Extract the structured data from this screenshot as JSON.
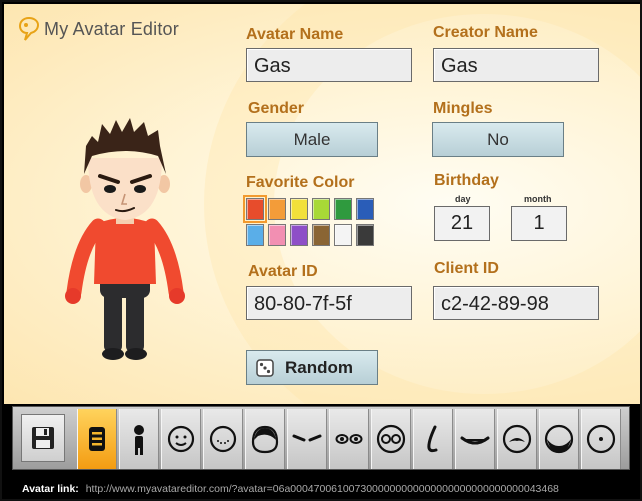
{
  "app": {
    "title": "My Avatar Editor",
    "icon": "speech-bubble-logo"
  },
  "form": {
    "avatar_name_label": "Avatar Name",
    "avatar_name_value": "Gas",
    "creator_name_label": "Creator Name",
    "creator_name_value": "Gas",
    "gender_label": "Gender",
    "gender_value": "Male",
    "mingles_label": "Mingles",
    "mingles_value": "No",
    "favorite_color_label": "Favorite Color",
    "birthday_label": "Birthday",
    "day_label": "day",
    "day_value": "21",
    "month_label": "month",
    "month_value": "1",
    "avatar_id_label": "Avatar ID",
    "avatar_id_value": "80-80-7f-5f",
    "client_id_label": "Client ID",
    "client_id_value": "c2-42-89-98",
    "random_label": "Random"
  },
  "favorite_colors": {
    "selected_index": 0,
    "swatches": [
      "#e74c2c",
      "#f39c39",
      "#f2e03a",
      "#a8d936",
      "#2f9a3e",
      "#2a5db8",
      "#5aaee8",
      "#f28fb2",
      "#8e4fc7",
      "#8a6534",
      "#f4f4f4",
      "#3a3a3a"
    ]
  },
  "toolbar": {
    "save_icon": "floppy-disk-icon",
    "active_index": 0,
    "tools": [
      "profile-list-icon",
      "body-icon",
      "face-icon",
      "face-features-icon",
      "hair-icon",
      "eyebrows-icon",
      "eyes-icon",
      "glasses-icon",
      "nose-icon",
      "mouth-icon",
      "mustache-icon",
      "beard-icon",
      "mole-icon"
    ]
  },
  "footer": {
    "link_label": "Avatar link:",
    "link_url": "http://www.myavatareditor.com/?avatar=06a0004700610073000000000000000000000000000043468"
  },
  "colors": {
    "accent_label": "#b3701c",
    "button_bg": "#c8dde3",
    "active_tool": "#f7b42c",
    "shirt": "#f04a2f"
  }
}
